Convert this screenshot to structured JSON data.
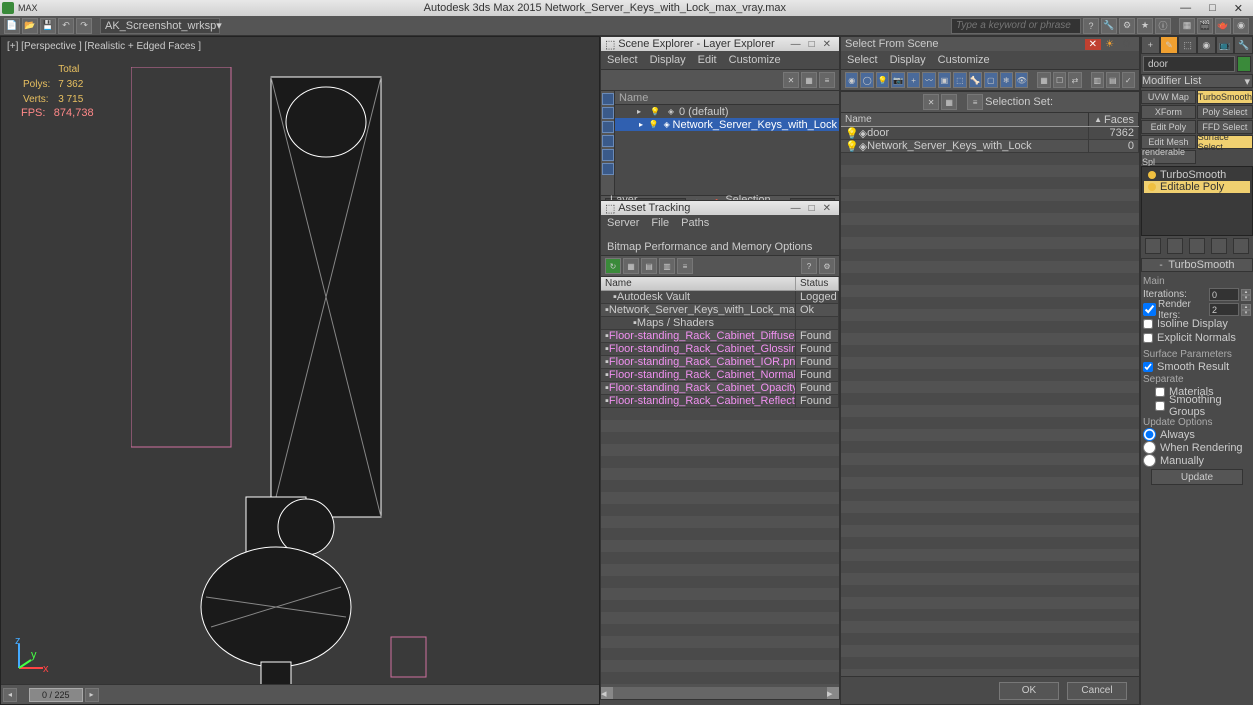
{
  "app": {
    "title_left": "AK_Screenshot_wrksp",
    "title_center": "Autodesk 3ds Max 2015   Network_Server_Keys_with_Lock_max_vray.max",
    "search_placeholder": "Type a keyword or phrase"
  },
  "viewport": {
    "label": "[+] [Perspective ] [Realistic + Edged Faces ]"
  },
  "stats": {
    "total_label": "Total",
    "polys_label": "Polys:",
    "polys": "7 362",
    "verts_label": "Verts:",
    "verts": "3 715",
    "fps_label": "FPS:",
    "fps": "874,738"
  },
  "timeline": {
    "pos": "0 / 225"
  },
  "scene_explorer": {
    "title": "Scene Explorer - Layer Explorer",
    "menu": [
      "Select",
      "Display",
      "Edit",
      "Customize"
    ],
    "columns": {
      "name": "Name"
    },
    "rows": [
      {
        "indent": 0,
        "label": "0 (default)",
        "sel": false
      },
      {
        "indent": 1,
        "label": "Network_Server_Keys_with_Lock",
        "sel": true
      }
    ],
    "footer": {
      "mode": "Layer Explorer",
      "selset": "Selection Set:"
    }
  },
  "asset_tracking": {
    "title": "Asset Tracking",
    "menu": [
      "Server",
      "File",
      "Paths",
      "Bitmap Performance and Memory Options"
    ],
    "columns": {
      "name": "Name",
      "status": "Status"
    },
    "rows": [
      {
        "indent": 0,
        "name": "Autodesk Vault",
        "status": "Logged",
        "type": "group"
      },
      {
        "indent": 1,
        "name": "Network_Server_Keys_with_Lock_max_vray.max",
        "status": "Ok",
        "type": "file"
      },
      {
        "indent": 2,
        "name": "Maps / Shaders",
        "status": "",
        "type": "group"
      },
      {
        "indent": 3,
        "name": "Floor-standing_Rack_Cabinet_Diffuse_W...",
        "status": "Found",
        "type": "map"
      },
      {
        "indent": 3,
        "name": "Floor-standing_Rack_Cabinet_Glossiness...",
        "status": "Found",
        "type": "map"
      },
      {
        "indent": 3,
        "name": "Floor-standing_Rack_Cabinet_IOR.png",
        "status": "Found",
        "type": "map"
      },
      {
        "indent": 3,
        "name": "Floor-standing_Rack_Cabinet_Normal.png",
        "status": "Found",
        "type": "map"
      },
      {
        "indent": 3,
        "name": "Floor-standing_Rack_Cabinet_Opacity.png",
        "status": "Found",
        "type": "map"
      },
      {
        "indent": 3,
        "name": "Floor-standing_Rack_Cabinet_Reflection...",
        "status": "Found",
        "type": "map"
      }
    ]
  },
  "select_scene": {
    "title": "Select From Scene",
    "menu": [
      "Select",
      "Display",
      "Customize"
    ],
    "selset": "Selection Set:",
    "columns": {
      "name": "Name",
      "faces": "Faces"
    },
    "rows": [
      {
        "name": "door",
        "faces": "7362"
      },
      {
        "name": "Network_Server_Keys_with_Lock",
        "faces": "0"
      }
    ],
    "ok": "OK",
    "cancel": "Cancel"
  },
  "cmdpanel": {
    "obj_name": "door",
    "modifier_list": "Modifier List",
    "mod_buttons": [
      "UVW Map",
      "TurboSmooth",
      "XForm",
      "Poly Select",
      "Edit Poly",
      "FFD Select",
      "Edit Mesh",
      "Surface Select",
      "renderable Spl"
    ],
    "stack": [
      {
        "name": "TurboSmooth",
        "on": true,
        "sel": false
      },
      {
        "name": "Editable Poly",
        "on": true,
        "sel": true
      }
    ],
    "turbosmooth": {
      "header": "TurboSmooth",
      "main": "Main",
      "iterations_label": "Iterations:",
      "iterations": "0",
      "render_iters_label": "Render Iters:",
      "render_iters": "2",
      "isoline": "Isoline Display",
      "explicit": "Explicit Normals",
      "surf_params": "Surface Parameters",
      "smooth_result": "Smooth Result",
      "separate": "Separate",
      "materials": "Materials",
      "smoothing_groups": "Smoothing Groups",
      "update_options": "Update Options",
      "always": "Always",
      "when_rendering": "When Rendering",
      "manually": "Manually",
      "update": "Update"
    }
  }
}
